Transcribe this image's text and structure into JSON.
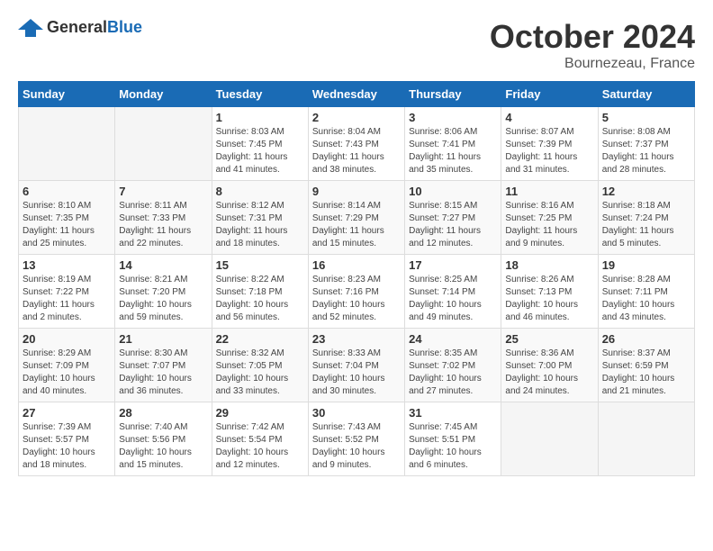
{
  "header": {
    "logo_general": "General",
    "logo_blue": "Blue",
    "month": "October 2024",
    "location": "Bournezeau, France"
  },
  "weekdays": [
    "Sunday",
    "Monday",
    "Tuesday",
    "Wednesday",
    "Thursday",
    "Friday",
    "Saturday"
  ],
  "weeks": [
    [
      {
        "day": "",
        "info": ""
      },
      {
        "day": "",
        "info": ""
      },
      {
        "day": "1",
        "info": "Sunrise: 8:03 AM\nSunset: 7:45 PM\nDaylight: 11 hours and 41 minutes."
      },
      {
        "day": "2",
        "info": "Sunrise: 8:04 AM\nSunset: 7:43 PM\nDaylight: 11 hours and 38 minutes."
      },
      {
        "day": "3",
        "info": "Sunrise: 8:06 AM\nSunset: 7:41 PM\nDaylight: 11 hours and 35 minutes."
      },
      {
        "day": "4",
        "info": "Sunrise: 8:07 AM\nSunset: 7:39 PM\nDaylight: 11 hours and 31 minutes."
      },
      {
        "day": "5",
        "info": "Sunrise: 8:08 AM\nSunset: 7:37 PM\nDaylight: 11 hours and 28 minutes."
      }
    ],
    [
      {
        "day": "6",
        "info": "Sunrise: 8:10 AM\nSunset: 7:35 PM\nDaylight: 11 hours and 25 minutes."
      },
      {
        "day": "7",
        "info": "Sunrise: 8:11 AM\nSunset: 7:33 PM\nDaylight: 11 hours and 22 minutes."
      },
      {
        "day": "8",
        "info": "Sunrise: 8:12 AM\nSunset: 7:31 PM\nDaylight: 11 hours and 18 minutes."
      },
      {
        "day": "9",
        "info": "Sunrise: 8:14 AM\nSunset: 7:29 PM\nDaylight: 11 hours and 15 minutes."
      },
      {
        "day": "10",
        "info": "Sunrise: 8:15 AM\nSunset: 7:27 PM\nDaylight: 11 hours and 12 minutes."
      },
      {
        "day": "11",
        "info": "Sunrise: 8:16 AM\nSunset: 7:25 PM\nDaylight: 11 hours and 9 minutes."
      },
      {
        "day": "12",
        "info": "Sunrise: 8:18 AM\nSunset: 7:24 PM\nDaylight: 11 hours and 5 minutes."
      }
    ],
    [
      {
        "day": "13",
        "info": "Sunrise: 8:19 AM\nSunset: 7:22 PM\nDaylight: 11 hours and 2 minutes."
      },
      {
        "day": "14",
        "info": "Sunrise: 8:21 AM\nSunset: 7:20 PM\nDaylight: 10 hours and 59 minutes."
      },
      {
        "day": "15",
        "info": "Sunrise: 8:22 AM\nSunset: 7:18 PM\nDaylight: 10 hours and 56 minutes."
      },
      {
        "day": "16",
        "info": "Sunrise: 8:23 AM\nSunset: 7:16 PM\nDaylight: 10 hours and 52 minutes."
      },
      {
        "day": "17",
        "info": "Sunrise: 8:25 AM\nSunset: 7:14 PM\nDaylight: 10 hours and 49 minutes."
      },
      {
        "day": "18",
        "info": "Sunrise: 8:26 AM\nSunset: 7:13 PM\nDaylight: 10 hours and 46 minutes."
      },
      {
        "day": "19",
        "info": "Sunrise: 8:28 AM\nSunset: 7:11 PM\nDaylight: 10 hours and 43 minutes."
      }
    ],
    [
      {
        "day": "20",
        "info": "Sunrise: 8:29 AM\nSunset: 7:09 PM\nDaylight: 10 hours and 40 minutes."
      },
      {
        "day": "21",
        "info": "Sunrise: 8:30 AM\nSunset: 7:07 PM\nDaylight: 10 hours and 36 minutes."
      },
      {
        "day": "22",
        "info": "Sunrise: 8:32 AM\nSunset: 7:05 PM\nDaylight: 10 hours and 33 minutes."
      },
      {
        "day": "23",
        "info": "Sunrise: 8:33 AM\nSunset: 7:04 PM\nDaylight: 10 hours and 30 minutes."
      },
      {
        "day": "24",
        "info": "Sunrise: 8:35 AM\nSunset: 7:02 PM\nDaylight: 10 hours and 27 minutes."
      },
      {
        "day": "25",
        "info": "Sunrise: 8:36 AM\nSunset: 7:00 PM\nDaylight: 10 hours and 24 minutes."
      },
      {
        "day": "26",
        "info": "Sunrise: 8:37 AM\nSunset: 6:59 PM\nDaylight: 10 hours and 21 minutes."
      }
    ],
    [
      {
        "day": "27",
        "info": "Sunrise: 7:39 AM\nSunset: 5:57 PM\nDaylight: 10 hours and 18 minutes."
      },
      {
        "day": "28",
        "info": "Sunrise: 7:40 AM\nSunset: 5:56 PM\nDaylight: 10 hours and 15 minutes."
      },
      {
        "day": "29",
        "info": "Sunrise: 7:42 AM\nSunset: 5:54 PM\nDaylight: 10 hours and 12 minutes."
      },
      {
        "day": "30",
        "info": "Sunrise: 7:43 AM\nSunset: 5:52 PM\nDaylight: 10 hours and 9 minutes."
      },
      {
        "day": "31",
        "info": "Sunrise: 7:45 AM\nSunset: 5:51 PM\nDaylight: 10 hours and 6 minutes."
      },
      {
        "day": "",
        "info": ""
      },
      {
        "day": "",
        "info": ""
      }
    ]
  ]
}
